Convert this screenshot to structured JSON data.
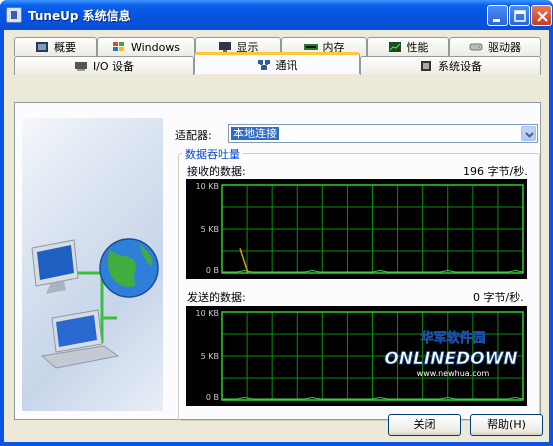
{
  "window": {
    "title": "TuneUp 系统信息"
  },
  "tabs_row1": [
    {
      "label": "概要",
      "icon": "summary-icon"
    },
    {
      "label": "Windows",
      "icon": "windows-icon"
    },
    {
      "label": "显示",
      "icon": "display-icon"
    },
    {
      "label": "内存",
      "icon": "memory-icon"
    },
    {
      "label": "性能",
      "icon": "performance-icon"
    },
    {
      "label": "驱动器",
      "icon": "drive-icon"
    }
  ],
  "tabs_row2": [
    {
      "label": "I/O 设备",
      "icon": "io-device-icon"
    },
    {
      "label": "通讯",
      "icon": "network-icon"
    },
    {
      "label": "系统设备",
      "icon": "system-device-icon"
    }
  ],
  "active_tab": "通讯",
  "adapter": {
    "label": "适配器:",
    "value": "本地连接"
  },
  "throughput": {
    "title": "数据吞吐量",
    "received": {
      "label": "接收的数据:",
      "rate": "196 字节/秒.",
      "ticks": [
        "10 KB",
        "5 KB",
        "0 B"
      ]
    },
    "sent": {
      "label": "发送的数据:",
      "rate": "0 字节/秒.",
      "ticks": [
        "10 KB",
        "5 KB",
        "0 B"
      ]
    }
  },
  "watermark": {
    "cn": "华军软件园",
    "en": "ONLINEDOWN",
    "url": "www.newhua.com"
  },
  "buttons": {
    "close": "关闭",
    "help": "帮助(H)"
  },
  "colors": {
    "grid": "#0a8f0a",
    "line": "#d8a000",
    "accent": "#ffc83c"
  }
}
